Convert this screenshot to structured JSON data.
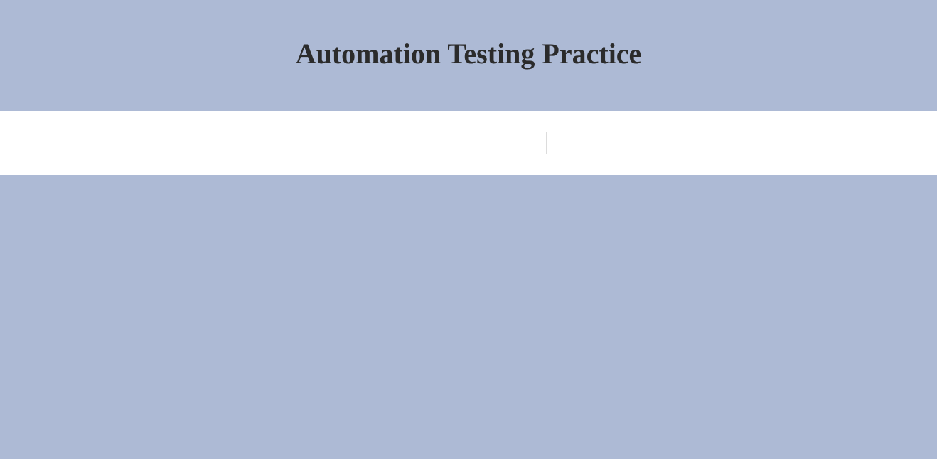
{
  "header": {
    "title": "Automation Testing Practice"
  },
  "colors": {
    "background": "#adbad5",
    "nav_background": "#ffffff",
    "title_text": "#2b2b2b",
    "divider": "#dcdcdc"
  }
}
